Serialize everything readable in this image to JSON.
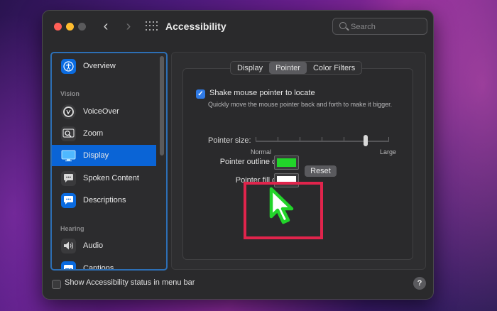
{
  "window": {
    "title": "Accessibility",
    "search_placeholder": "Search"
  },
  "sidebar": {
    "items": [
      {
        "label": "Overview",
        "icon": "accessibility-person-icon",
        "color": "#0a6be0"
      },
      {
        "label": "VoiceOver",
        "icon": "voiceover-icon",
        "color": "#3a3a3c"
      },
      {
        "label": "Zoom",
        "icon": "zoom-icon",
        "color": "#3a3a3c"
      },
      {
        "label": "Display",
        "icon": "display-icon",
        "color": "#0a6be0",
        "selected": true
      },
      {
        "label": "Spoken Content",
        "icon": "speech-bubble-icon",
        "color": "#3a3a3c"
      },
      {
        "label": "Descriptions",
        "icon": "descriptions-icon",
        "color": "#0a6be0"
      },
      {
        "label": "Audio",
        "icon": "speaker-icon",
        "color": "#3a3a3c"
      },
      {
        "label": "Captions",
        "icon": "captions-icon",
        "color": "#0a6be0"
      }
    ],
    "sections": {
      "vision": "Vision",
      "hearing": "Hearing"
    }
  },
  "tabs": [
    {
      "label": "Display",
      "active": false
    },
    {
      "label": "Pointer",
      "active": true
    },
    {
      "label": "Color Filters",
      "active": false
    }
  ],
  "pointer": {
    "shake_label": "Shake mouse pointer to locate",
    "shake_checked": true,
    "shake_desc": "Quickly move the mouse pointer back and forth to make it bigger.",
    "size_label": "Pointer size:",
    "size_min": "Normal",
    "size_max": "Large",
    "size_value": 0.82,
    "outline_label": "Pointer outline color:",
    "outline_color": "#22d42a",
    "fill_label": "Pointer fill color:",
    "fill_color": "#ffffff",
    "reset_label": "Reset"
  },
  "footer": {
    "status_label": "Show Accessibility status in menu bar",
    "help_label": "?"
  },
  "colors": {
    "accent": "#0a64d6",
    "highlight": "#e0244c"
  }
}
